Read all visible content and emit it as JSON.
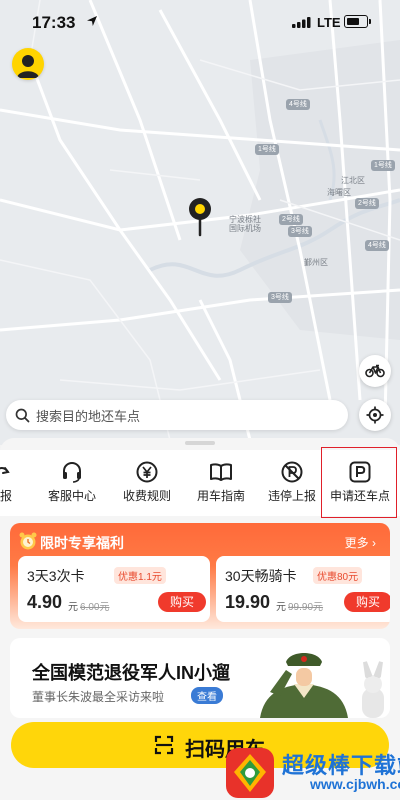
{
  "status_bar": {
    "time": "17:33",
    "network": "LTE"
  },
  "map": {
    "labels": {
      "airport": "宁波栎社\n国际机场",
      "jiangbei": "江北区",
      "haishu": "海曙区",
      "yinzhou": "鄞州区"
    },
    "road_badges": [
      "4号线",
      "1号线",
      "2号线",
      "3号线",
      "2号线",
      "4号线",
      "3号线",
      "1号线"
    ]
  },
  "search": {
    "placeholder": "搜索目的地还车点"
  },
  "quick_actions": [
    {
      "label": "上报",
      "icon": "report-icon"
    },
    {
      "label": "客服中心",
      "icon": "headset-icon"
    },
    {
      "label": "收费规则",
      "icon": "yuan-coin-icon"
    },
    {
      "label": "用车指南",
      "icon": "book-icon"
    },
    {
      "label": "违停上报",
      "icon": "no-parking-icon"
    },
    {
      "label": "申请还车点",
      "icon": "parking-p-icon"
    }
  ],
  "promo": {
    "title": "限时专享福利",
    "more": "更多 ›",
    "cards": [
      {
        "name": "3天3次卡",
        "tag": "优惠1.1元",
        "price": "4.90",
        "unit": "元",
        "original": "6.00元",
        "buy": "购买"
      },
      {
        "name": "30天畅骑卡",
        "tag": "优惠80元",
        "price": "19.90",
        "unit": "元",
        "original": "99.90元",
        "buy": "购买"
      }
    ]
  },
  "news": {
    "headline": "全国模范退役军人IN小遛",
    "subtitle": "董事长朱波最全采访来啦",
    "cta": "查看"
  },
  "scan_button": {
    "label": "扫码用车"
  },
  "watermark": {
    "brand": "超级棒下载站",
    "url": "www.cjbwh.com"
  },
  "colors": {
    "accent_yellow": "#ffd60a",
    "promo_orange": "#ff6a3a",
    "buy_red": "#f03a2c",
    "highlight_red": "#e0202a"
  }
}
